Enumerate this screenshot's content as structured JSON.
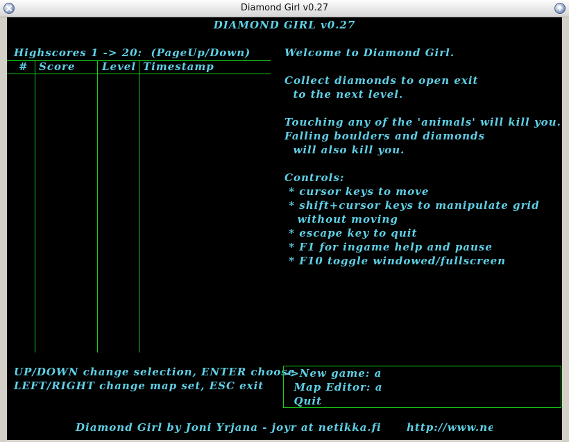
{
  "window": {
    "title": "Diamond Girl v0.27"
  },
  "game": {
    "title": "DIAMOND GIRL v0.27",
    "highscores": {
      "title": "Highscores 1 -> 20:  (PageUp/Down)",
      "columns": [
        "#",
        "Score",
        "Level",
        "Timestamp"
      ],
      "rows": []
    },
    "help_lines": [
      "Welcome to Diamond Girl.",
      "",
      "Collect diamonds to open exit",
      "  to the next level.",
      "",
      "Touching any of the 'animals' will kill you.",
      "Falling boulders and diamonds",
      "  will also kill you.",
      "",
      "Controls:",
      " * cursor keys to move",
      " * shift+cursor keys to manipulate grid",
      "   without moving",
      " * escape key to quit",
      " * F1 for ingame help and pause",
      " * F10 toggle windowed/fullscreen"
    ],
    "instructions": [
      "UP/DOWN change selection, ENTER choose",
      "LEFT/RIGHT change map set, ESC exit"
    ],
    "menu": {
      "selected_index": 0,
      "items": [
        "->New game: a",
        "  Map Editor: a",
        "  Quit"
      ]
    },
    "footer": {
      "credit": "Diamond Girl by Joni Yrjana - joyr at netikka.fi",
      "url": "http://www.ne"
    }
  },
  "colors": {
    "text": "#5fd0e6",
    "grid": "#18d018",
    "background": "#000000"
  }
}
